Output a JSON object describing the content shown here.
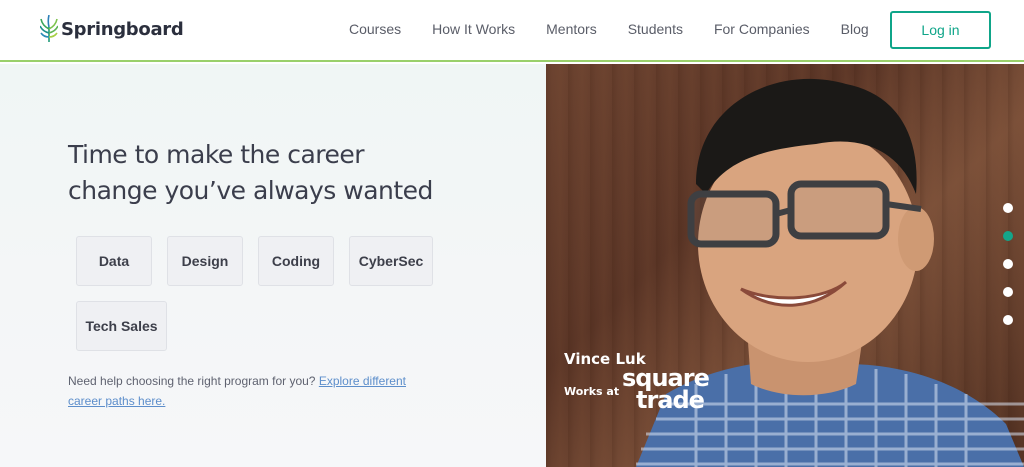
{
  "header": {
    "logo_text": "Springboard",
    "nav": [
      "Courses",
      "How It Works",
      "Mentors",
      "Students",
      "For Companies",
      "Blog"
    ],
    "login_label": "Log in"
  },
  "hero": {
    "headline_line1": "Time to make the career",
    "headline_line2": "change you’ve always wanted",
    "categories": [
      "Data",
      "Design",
      "Coding",
      "CyberSec",
      "Tech Sales"
    ],
    "help_text": "Need help choosing the right program for you?",
    "help_link": "Explore different career paths here."
  },
  "testimonial": {
    "name": "Vince Luk",
    "works_at_label": "Works at",
    "company_line1": "square",
    "company_line2": "trade"
  },
  "carousel": {
    "active_index": 1,
    "total": 5
  },
  "colors": {
    "accent": "#0fa589",
    "header_border": "#9ad06b",
    "link": "#5d8ecb",
    "text_dark": "#3b3e4c"
  }
}
